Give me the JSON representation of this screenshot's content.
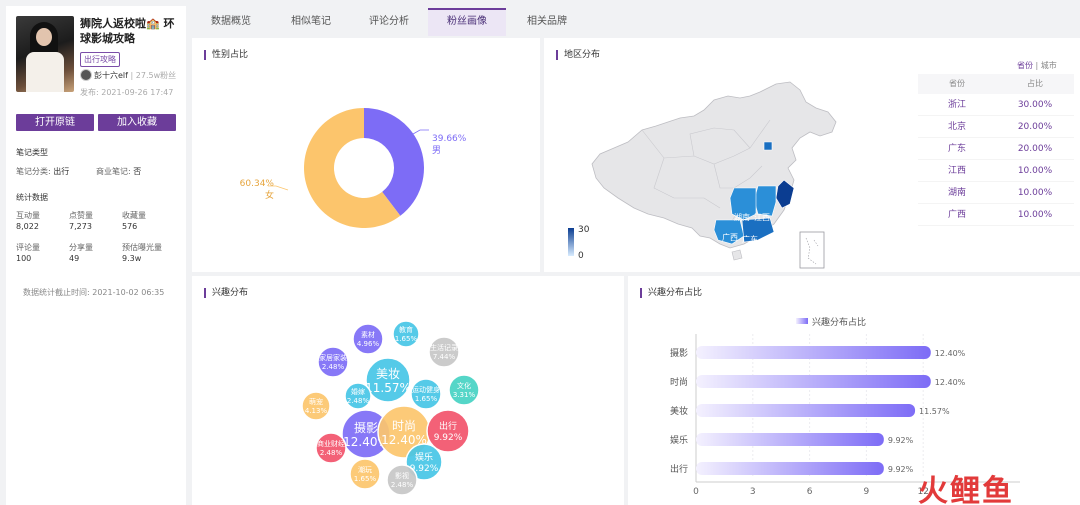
{
  "note": {
    "title": "狮院人返校啦🏫 环球影城攻略",
    "tag": "出行攻略",
    "author": "彭十六elf",
    "fans": "27.5w粉丝",
    "publish_time": "发布: 2021-09-26 17:47",
    "open_button": "打开原链",
    "favorite_button": "加入收藏"
  },
  "note_type": {
    "heading": "笔记类型",
    "category_label": "笔记分类:",
    "category_value": "出行",
    "commercial_label": "商业笔记:",
    "commercial_value": "否"
  },
  "stats": {
    "heading": "统计数据",
    "items": [
      {
        "label": "互动量",
        "value": "8,022"
      },
      {
        "label": "点赞量",
        "value": "7,273"
      },
      {
        "label": "收藏量",
        "value": "576"
      },
      {
        "label": "评论量",
        "value": "100"
      },
      {
        "label": "分享量",
        "value": "49"
      },
      {
        "label": "预估曝光量",
        "value": "9.3w"
      }
    ],
    "cutoff": "数据统计截止时间: 2021-10-02 06:35"
  },
  "tabs": [
    "数据概览",
    "相似笔记",
    "评论分析",
    "粉丝画像",
    "相关品牌"
  ],
  "active_tab": "粉丝画像",
  "gender": {
    "title": "性别占比",
    "male": {
      "label": "男",
      "pct": "39.66%",
      "value": 39.66,
      "color": "#7d6cf6"
    },
    "female": {
      "label": "女",
      "pct": "60.34%",
      "value": 60.34,
      "color": "#fcc56c"
    }
  },
  "region": {
    "title": "地区分布",
    "toggle_province": "省份",
    "toggle_city": "城市",
    "legend_max": "30",
    "legend_min": "0",
    "table_header": [
      "省份",
      "占比"
    ],
    "rows": [
      {
        "name": "浙江",
        "pct": "30.00%"
      },
      {
        "name": "北京",
        "pct": "20.00%"
      },
      {
        "name": "广东",
        "pct": "20.00%"
      },
      {
        "name": "江西",
        "pct": "10.00%"
      },
      {
        "name": "湖南",
        "pct": "10.00%"
      },
      {
        "name": "广西",
        "pct": "10.00%"
      }
    ],
    "map_labels": [
      "湖南",
      "江西",
      "广西",
      "广东"
    ]
  },
  "interest": {
    "title": "兴趣分布",
    "bubbles": [
      {
        "name": "摄影",
        "pct": "12.40%",
        "color": "#7d6cf6"
      },
      {
        "name": "时尚",
        "pct": "12.40%",
        "color": "#fcc56c"
      },
      {
        "name": "美妆",
        "pct": "11.57%",
        "color": "#46c6e6"
      },
      {
        "name": "出行",
        "pct": "9.92%",
        "color": "#f2546b"
      },
      {
        "name": "娱乐",
        "pct": "9.92%",
        "color": "#46c6e6"
      },
      {
        "name": "萌宠",
        "pct": "4.13%",
        "color": "#fcc56c"
      },
      {
        "name": "素材",
        "pct": "4.96%",
        "color": "#7d6cf6"
      },
      {
        "name": "教育",
        "pct": "1.65%",
        "color": "#46c6e6"
      },
      {
        "name": "生活记录",
        "pct": "7.44%",
        "color": "#c7c7c7"
      },
      {
        "name": "家居家装",
        "pct": "2.48%",
        "color": "#7d6cf6"
      },
      {
        "name": "运动健身",
        "pct": "1.65%",
        "color": "#46c6e6"
      },
      {
        "name": "文化",
        "pct": "3.31%",
        "color": "#46d2c3"
      },
      {
        "name": "婚嫁",
        "pct": "2.48%",
        "color": "#46c6e6"
      },
      {
        "name": "商业财经",
        "pct": "2.48%",
        "color": "#f2546b"
      },
      {
        "name": "潮玩",
        "pct": "1.65%",
        "color": "#fcc56c"
      },
      {
        "name": "影视",
        "pct": "2.48%",
        "color": "#c7c7c7"
      }
    ]
  },
  "chart_data": {
    "type": "bar",
    "orientation": "horizontal",
    "title": "兴趣分布占比",
    "legend": "兴趣分布占比",
    "categories": [
      "摄影",
      "时尚",
      "美妆",
      "娱乐",
      "出行"
    ],
    "values": [
      12.4,
      12.4,
      11.57,
      9.92,
      9.92
    ],
    "value_labels": [
      "12.40%",
      "12.40%",
      "11.57%",
      "9.92%",
      "9.92%"
    ],
    "xticks": [
      "0",
      "3",
      "6",
      "9",
      "12"
    ],
    "xlim": [
      0,
      15
    ],
    "grid": "vertical",
    "color": "#7d6cf6"
  },
  "watermark": "火鲤鱼"
}
